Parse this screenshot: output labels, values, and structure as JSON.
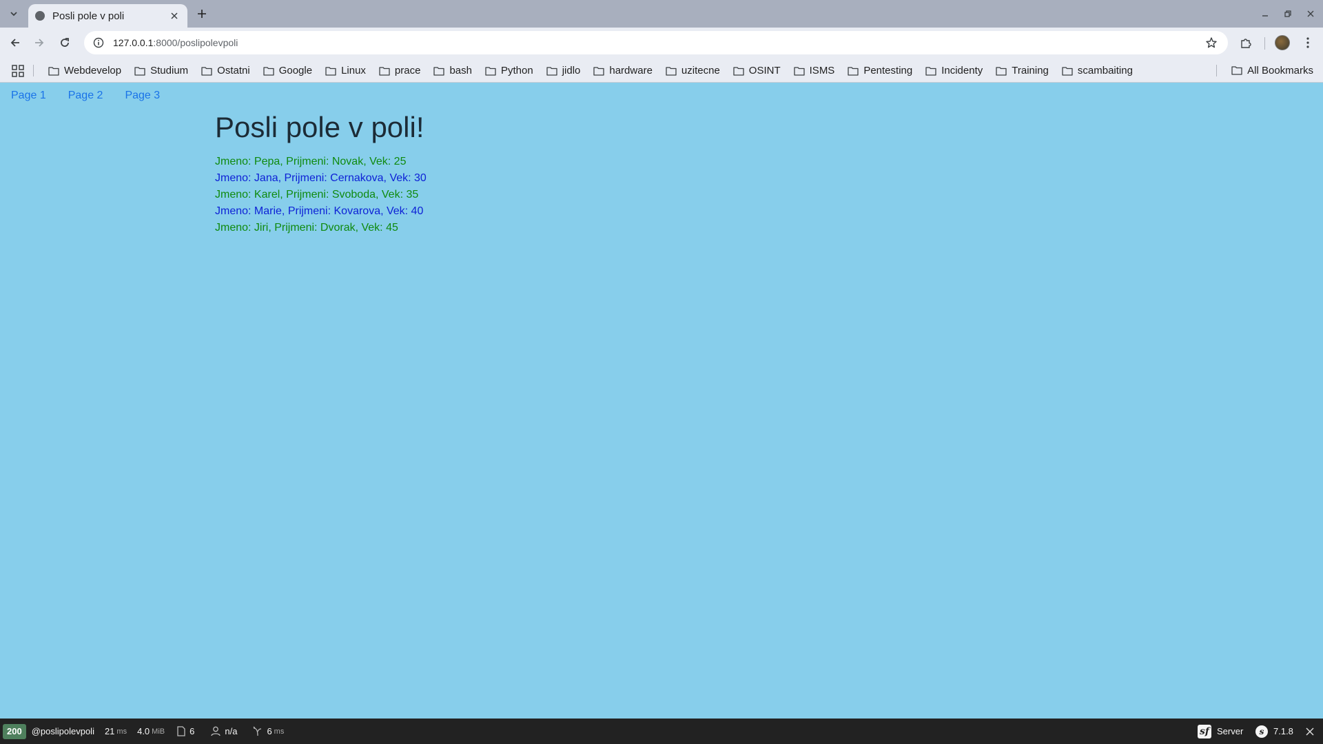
{
  "browser": {
    "tab": {
      "title": "Posli pole v poli"
    },
    "url": {
      "host": "127.0.0.1",
      "path": ":8000/poslipolevpoli"
    },
    "bookmarks": [
      "Webdevelop",
      "Studium",
      "Ostatni",
      "Google",
      "Linux",
      "prace",
      "bash",
      "Python",
      "jidlo",
      "hardware",
      "uzitecne",
      "OSINT",
      "ISMS",
      "Pentesting",
      "Incidenty",
      "Training",
      "scambaiting"
    ],
    "all_bookmarks": "All Bookmarks"
  },
  "page": {
    "nav": [
      "Page 1",
      "Page 2",
      "Page 3"
    ],
    "heading": "Posli pole v poli!",
    "people": [
      {
        "text": "Jmeno: Pepa, Prijmeni: Novak, Vek: 25",
        "color": "#0f8a0f"
      },
      {
        "text": "Jmeno: Jana, Prijmeni: Cernakova, Vek: 30",
        "color": "#0e22d6"
      },
      {
        "text": "Jmeno: Karel, Prijmeni: Svoboda, Vek: 35",
        "color": "#0f8a0f"
      },
      {
        "text": "Jmeno: Marie, Prijmeni: Kovarova, Vek: 40",
        "color": "#0e22d6"
      },
      {
        "text": "Jmeno: Jiri, Prijmeni: Dvorak, Vek: 45",
        "color": "#0f8a0f"
      }
    ],
    "background": "#87ceeb"
  },
  "debug_toolbar": {
    "status": "200",
    "route": "@poslipolevpoli",
    "time": {
      "value": "21",
      "unit": "ms"
    },
    "memory": {
      "value": "4.0",
      "unit": "MiB"
    },
    "templates": "6",
    "user": "n/a",
    "twig": {
      "value": "6",
      "unit": "ms"
    },
    "server_label": "Server",
    "version": "7.1.8"
  }
}
